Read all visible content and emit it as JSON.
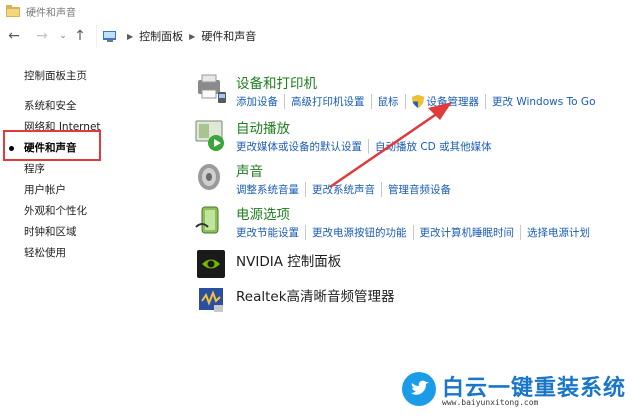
{
  "window": {
    "title": "硬件和声音"
  },
  "address": {
    "crumbs": [
      "控制面板",
      "硬件和声音"
    ]
  },
  "leftnav": {
    "items": [
      "控制面板主页",
      "系统和安全",
      "网络和 Internet",
      "硬件和声音",
      "程序",
      "用户帐户",
      "外观和个性化",
      "时钟和区域",
      "轻松使用"
    ],
    "current_index": 3
  },
  "categories": [
    {
      "title": "设备和打印机",
      "links": [
        "添加设备",
        "高级打印机设置",
        "鼠标",
        "设备管理器",
        "更改 Windows To Go"
      ]
    },
    {
      "title": "自动播放",
      "links": [
        "更改媒体或设备的默认设置",
        "自动播放 CD 或其他媒体"
      ]
    },
    {
      "title": "声音",
      "links": [
        "调整系统音量",
        "更改系统声音",
        "管理音频设备"
      ]
    },
    {
      "title": "电源选项",
      "links": [
        "更改节能设置",
        "更改电源按钮的功能",
        "更改计算机睡眠时间",
        "选择电源计划"
      ]
    },
    {
      "title": "NVIDIA 控制面板",
      "links": []
    },
    {
      "title": "Realtek高清晰音频管理器",
      "links": []
    }
  ],
  "watermark": {
    "text": "白云一键重装系统",
    "url": "www.baiyunxitong.com"
  },
  "colors": {
    "link": "#1a5cb8",
    "category_title": "#1e7e1e",
    "annotation": "#e03a3a"
  },
  "icons": [
    "back-arrow-icon",
    "forward-arrow-icon",
    "up-arrow-icon",
    "control-panel-icon",
    "devices-printers-icon",
    "autoplay-icon",
    "sound-icon",
    "power-options-icon",
    "nvidia-icon",
    "realtek-icon",
    "uac-shield-icon"
  ]
}
